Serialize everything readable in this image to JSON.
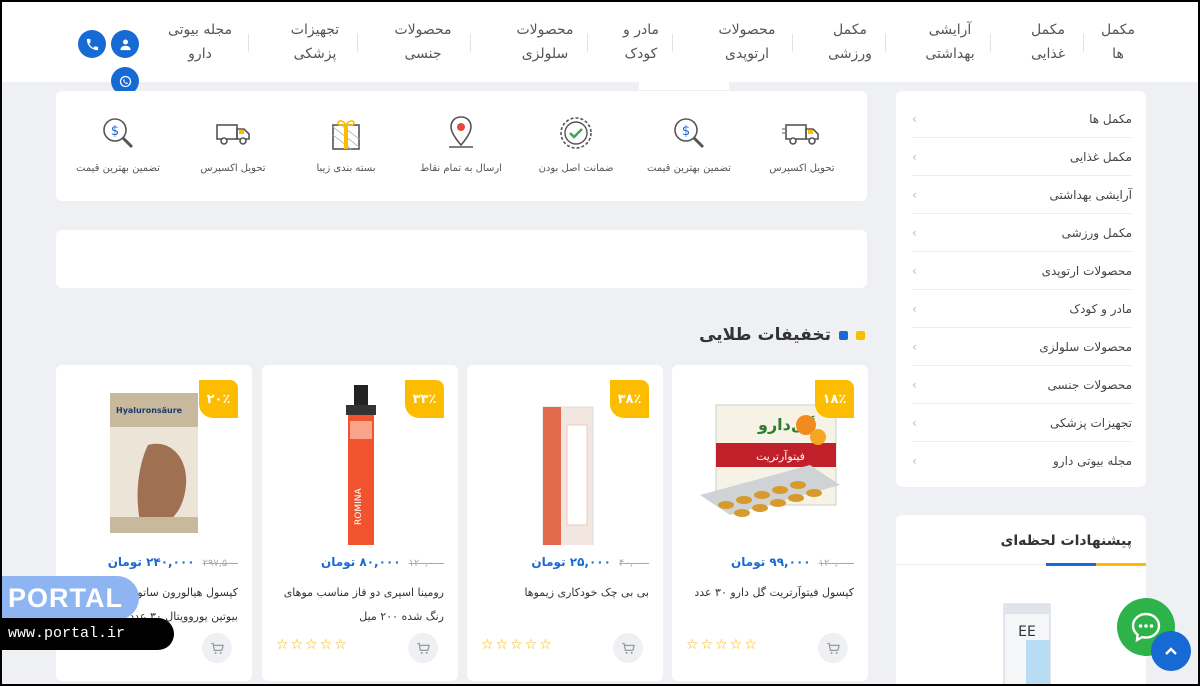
{
  "nav": {
    "items": [
      {
        "label": "مکمل ها"
      },
      {
        "label": "مکمل غذایی"
      },
      {
        "label": "آرایشی بهداشتی"
      },
      {
        "label": "مکمل ورزشی"
      },
      {
        "label": "محصولات ارتوپدی"
      },
      {
        "label": "مادر و کودک"
      },
      {
        "label": "محصولات سلولزی"
      },
      {
        "label": "محصولات جنسی"
      },
      {
        "label": "تجهیزات پزشکی"
      },
      {
        "label": "مجله بیوتی دارو"
      }
    ]
  },
  "contact": {
    "phone_icon": "phone-icon",
    "user_icon": "user-icon",
    "whatsapp_icon": "whatsapp-icon"
  },
  "features": [
    {
      "label": "تحویل اکسپرس",
      "icon": "truck-icon"
    },
    {
      "label": "تضمین بهترین قیمت",
      "icon": "price-search-icon"
    },
    {
      "label": "ضمانت اصل بودن",
      "icon": "check-badge-icon"
    },
    {
      "label": "ارسال به تمام نقاط",
      "icon": "location-icon"
    },
    {
      "label": "بسته بندی زیبا",
      "icon": "gift-icon"
    },
    {
      "label": "تحویل اکسپرس",
      "icon": "truck-icon"
    },
    {
      "label": "تضمین بهترین قیمت",
      "icon": "price-search-icon"
    }
  ],
  "section": {
    "title": "تخفیفات طلایی"
  },
  "products": [
    {
      "badge": "۱۸٪",
      "old_price": "۱۲۰,۰۰۰",
      "new_price": "۹۹,۰۰۰ تومان",
      "name": "کپسول فیتوآرتریت گل دارو ۳۰ عدد",
      "stars": "☆☆☆☆☆"
    },
    {
      "badge": "۳۸٪",
      "old_price": "۴۰,۰۰۰",
      "new_price": "۲۵,۰۰۰ تومان",
      "name": "بی بی چک خودکاری زیموها",
      "stars": "☆☆☆☆☆"
    },
    {
      "badge": "۳۳٪",
      "old_price": "۱۲۰,۰۰۰",
      "new_price": "۸۰,۰۰۰ تومان",
      "name": "رومینا اسپری دو فاز مناسب موهای رنگ شده ۲۰۰ میل",
      "stars": "☆☆☆☆☆"
    },
    {
      "badge": "۲۰٪",
      "old_price": "۲۹۷,۵۰۰",
      "new_price": "۲۴۰,۰۰۰ تومان",
      "name": "کپسول هیالورون ساتور کلاژن و بیوتین یوروویتال ۳۰ عدد",
      "stars": "☆☆☆☆☆"
    }
  ],
  "sidebar": {
    "items": [
      {
        "label": "مکمل ها"
      },
      {
        "label": "مکمل غذایی"
      },
      {
        "label": "آرایشی بهداشتی"
      },
      {
        "label": "مکمل ورزشی"
      },
      {
        "label": "محصولات ارتوپدی"
      },
      {
        "label": "مادر و کودک"
      },
      {
        "label": "محصولات سلولزی"
      },
      {
        "label": "محصولات جنسی"
      },
      {
        "label": "تجهیزات پزشکی"
      },
      {
        "label": "مجله بیوتی دارو"
      }
    ],
    "suggest_title": "پیشنهادات لحظه‌ای"
  },
  "watermark": {
    "brand": "PORTAL",
    "url": "www.portal.ir"
  },
  "colors": {
    "accent_blue": "#1769d3",
    "accent_yellow": "#fcbd00",
    "chat_green": "#2eb24a"
  }
}
